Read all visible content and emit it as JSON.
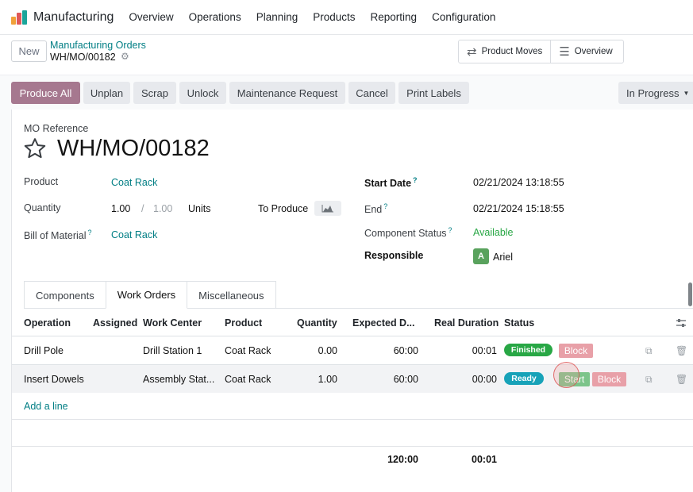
{
  "nav": {
    "app_title": "Manufacturing",
    "menu": [
      "Overview",
      "Operations",
      "Planning",
      "Products",
      "Reporting",
      "Configuration"
    ]
  },
  "control": {
    "new_label": "New",
    "breadcrumb_parent": "Manufacturing Orders",
    "breadcrumb_current": "WH/MO/00182",
    "smart_buttons": [
      "Product Moves",
      "Overview"
    ]
  },
  "actions": {
    "buttons": [
      "Produce All",
      "Unplan",
      "Scrap",
      "Unlock",
      "Maintenance Request",
      "Cancel",
      "Print Labels"
    ],
    "status": "In Progress"
  },
  "form": {
    "ref_label": "MO Reference",
    "title": "WH/MO/00182",
    "product_label": "Product",
    "product": "Coat Rack",
    "quantity_label": "Quantity",
    "quantity": "1.00",
    "quantity_sep": "/",
    "quantity_total": "1.00",
    "uom": "Units",
    "to_produce_label": "To Produce",
    "bom_label": "Bill of Material",
    "bom": "Coat Rack",
    "start_label": "Start Date",
    "start": "02/21/2024 13:18:55",
    "end_label": "End",
    "end": "02/21/2024 15:18:55",
    "component_label": "Component Status",
    "component_status": "Available",
    "responsible_label": "Responsible",
    "responsible_initial": "A",
    "responsible": "Ariel",
    "help_mark": "?"
  },
  "tabs": [
    "Components",
    "Work Orders",
    "Miscellaneous"
  ],
  "table": {
    "columns": [
      "Operation",
      "Assigned",
      "Work Center",
      "Product",
      "Quantity",
      "Expected D...",
      "Real Duration",
      "Status"
    ],
    "rows": [
      {
        "operation": "Drill Pole",
        "assigned": "",
        "work_center": "Drill Station 1",
        "product": "Coat Rack",
        "quantity": "0.00",
        "expected": "60:00",
        "real": "00:01",
        "status": "Finished",
        "buttons": [
          "Block"
        ]
      },
      {
        "operation": "Insert Dowels",
        "assigned": "",
        "work_center": "Assembly Stat...",
        "product": "Coat Rack",
        "quantity": "1.00",
        "expected": "60:00",
        "real": "00:00",
        "status": "Ready",
        "buttons": [
          "Start",
          "Block"
        ]
      }
    ],
    "add_line": "Add a line",
    "total_expected": "120:00",
    "total_real": "00:01"
  },
  "colors": {
    "primary": "#a6788f",
    "link": "#017e84",
    "finished": "#28a745",
    "ready": "#17a2b8",
    "block": "#e8a0a8",
    "start": "#7cc48a"
  }
}
